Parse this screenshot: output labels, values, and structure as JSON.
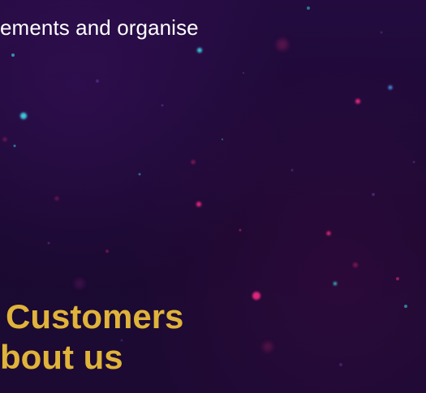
{
  "text_block": {
    "partial_line": "ements and organise"
  },
  "heading": {
    "line1": "Customers",
    "line2": "bout us"
  },
  "colors": {
    "background": "#1d0a35",
    "body_text": "#ffffff",
    "heading_text": "#e0b33a",
    "particle_cyan": "#3dc8dc",
    "particle_pink": "#e0287a",
    "particle_blue": "#4a8fe0"
  }
}
